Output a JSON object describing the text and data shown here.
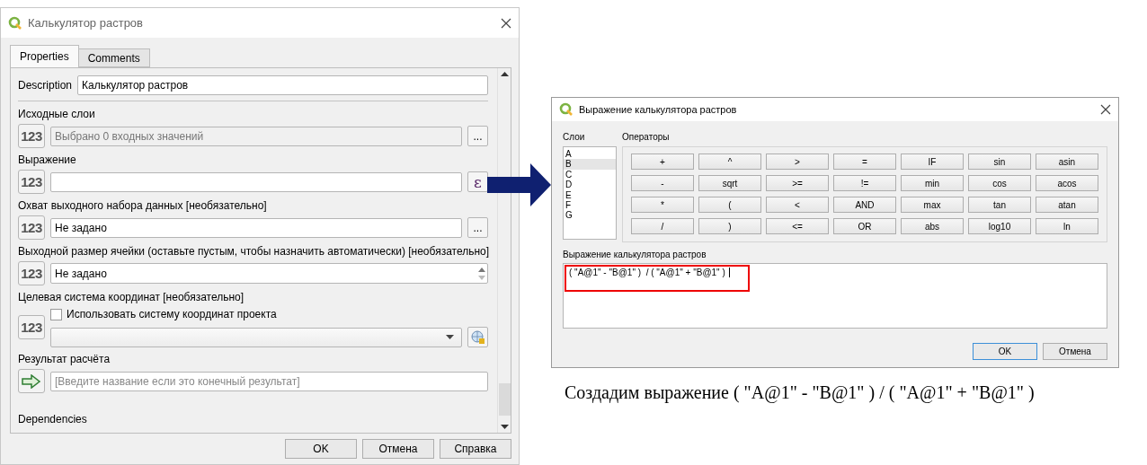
{
  "left_dialog": {
    "title": "Калькулятор растров",
    "tabs": [
      {
        "label": "Properties",
        "selected": true
      },
      {
        "label": "Comments",
        "selected": false
      }
    ],
    "description": {
      "label": "Description",
      "value": "Калькулятор растров"
    },
    "params": [
      {
        "kind": "layers",
        "label": "Исходные слои",
        "icon_text": "123",
        "value": "Выбрано 0 входных значений",
        "disabled": true,
        "button": "..."
      },
      {
        "kind": "expression",
        "label": "Выражение",
        "icon_text": "123",
        "disabled": false,
        "button": "ε"
      },
      {
        "kind": "extent",
        "label": "Охват выходного набора данных [необязательно]",
        "icon_text": "123",
        "value": "Не задано",
        "disabled": false,
        "button": "..."
      },
      {
        "kind": "spin",
        "label": "Выходной размер ячейки (оставьте пустым, чтобы назначить автоматически) [необязательно]",
        "icon_text": "123",
        "value": "Не задано"
      },
      {
        "kind": "crs",
        "label": "Целевая система координат [необязательно]",
        "icon_text": "123",
        "checkbox": {
          "label": "Использовать систему координат проекта",
          "checked": false
        }
      },
      {
        "kind": "output",
        "label": "Результат расчёта",
        "placeholder": "[Введите название если это конечный результат]"
      }
    ],
    "dependencies": "Dependencies",
    "buttons": [
      "OK",
      "Отмена",
      "Справка"
    ]
  },
  "right_dialog": {
    "title": "Выражение калькулятора растров",
    "layers_label": "Слои",
    "layers": [
      {
        "label": "A",
        "selected": false
      },
      {
        "label": "B",
        "selected": true
      },
      {
        "label": "C",
        "selected": false
      },
      {
        "label": "D",
        "selected": false
      },
      {
        "label": "E",
        "selected": false
      },
      {
        "label": "F",
        "selected": false
      },
      {
        "label": "G",
        "selected": false
      }
    ],
    "operators_label": "Операторы",
    "operators": [
      "+",
      "^",
      ">",
      "=",
      "IF",
      "sin",
      "asin",
      "-",
      "sqrt",
      ">=",
      "!=",
      "min",
      "cos",
      "acos",
      "*",
      "(",
      "<",
      "AND",
      "max",
      "tan",
      "atan",
      "/",
      ")",
      "<=",
      "OR",
      "abs",
      "log10",
      "ln"
    ],
    "expression_label": "Выражение калькулятора растров",
    "expression": "( \"A@1\" - \"B@1\" )  / ( \"A@1\" + \"B@1\" )",
    "buttons": [
      {
        "label": "OK",
        "default": true
      },
      {
        "label": "Отмена",
        "default": false
      }
    ]
  },
  "caption": "Создадим выражение ( \"A@1\" - \"B@1\" ) / ( \"A@1\" + \"B@1\" )"
}
